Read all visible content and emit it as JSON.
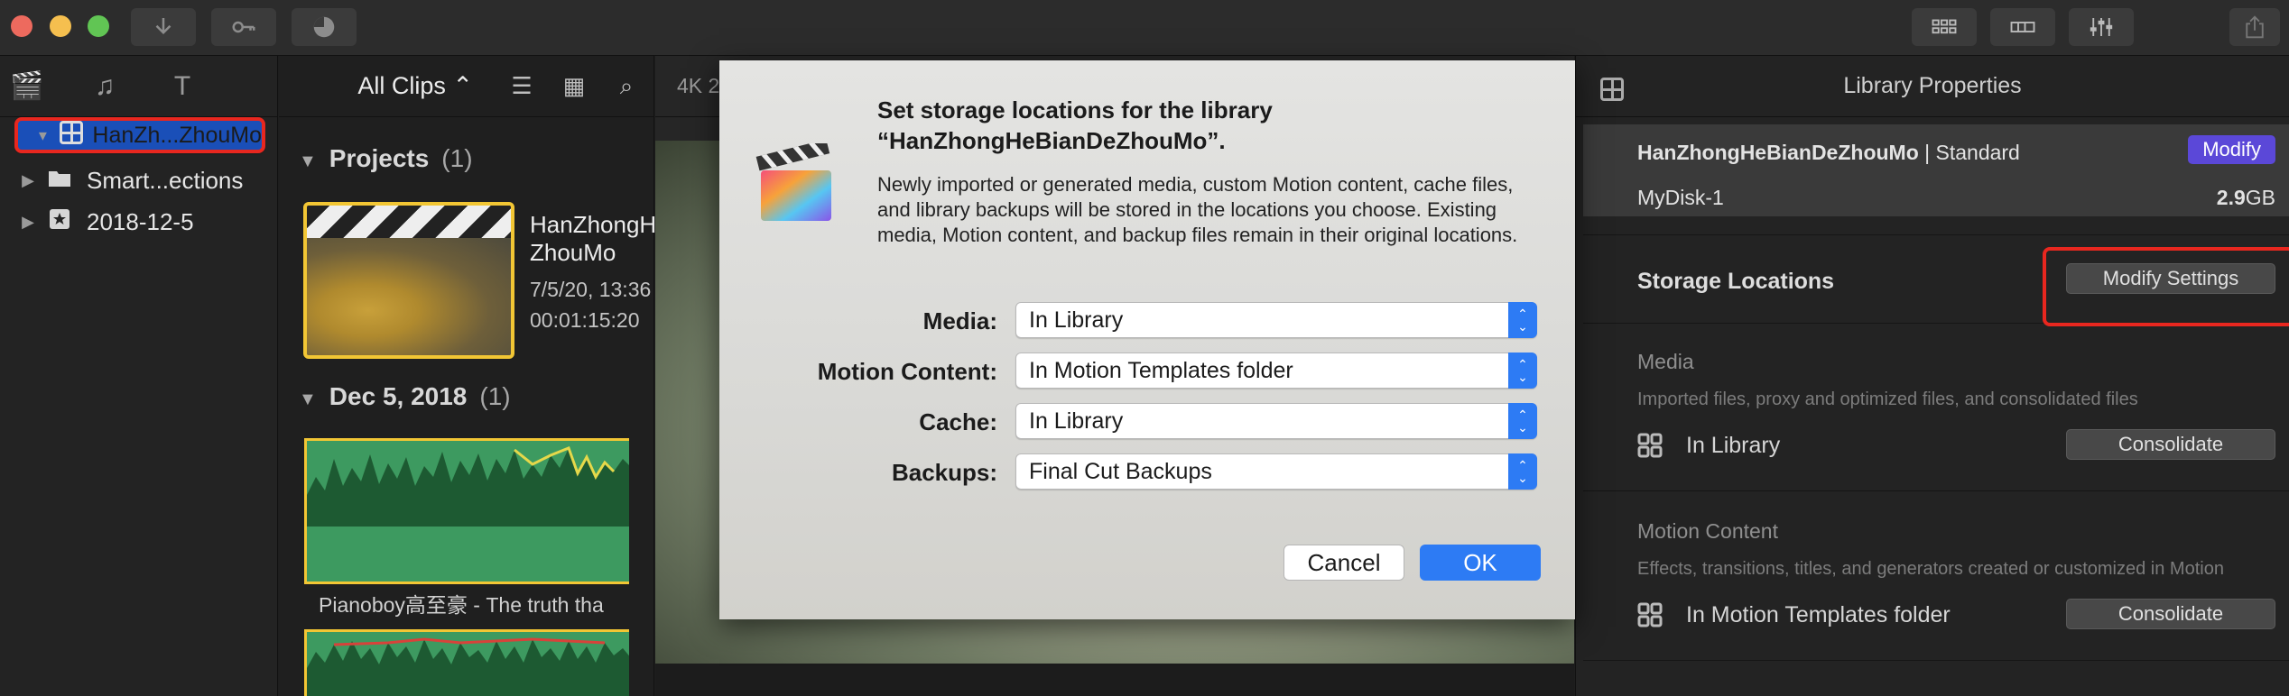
{
  "toolbar": {
    "import_icon": "download-arrow-icon",
    "keywords_icon": "key-icon",
    "background_tasks_icon": "progress-circle-icon",
    "right_buttons": [
      "grid-view-icon",
      "filmstrip-icon",
      "sliders-icon"
    ],
    "share_icon": "share-icon"
  },
  "sidebar": {
    "items": [
      {
        "label": "HanZh...ZhouMo",
        "icon": "library-icon"
      },
      {
        "label": "Smart...ections",
        "icon": "folder-icon"
      },
      {
        "label": "2018-12-5",
        "icon": "star-icon"
      }
    ]
  },
  "browser": {
    "filter": "All Clips ⌃",
    "projects": {
      "title": "Projects",
      "count": "(1)"
    },
    "project_clip": {
      "name_line1": "HanZhongH",
      "name_line2": "ZhouMo",
      "date": "7/5/20, 13:36",
      "duration": "00:01:15:20"
    },
    "event": {
      "title": "Dec 5, 2018",
      "count": "(1)"
    },
    "audio_caption": "Pianoboy高至豪 - The truth tha"
  },
  "viewer": {
    "format": "4K 2"
  },
  "inspector": {
    "title": "Library Properties",
    "library_name": "HanZhongHeBianDeZhouMo",
    "library_sep": " | Standard",
    "modify_label": "Modify",
    "disk_name": "MyDisk-1",
    "disk_size_num": "2.9",
    "disk_size_unit": "GB",
    "storage_title": "Storage Locations",
    "modify_settings_label": "Modify Settings",
    "media_label": "Media",
    "media_desc": "Imported files, proxy and optimized files, and consolidated files",
    "media_value": "In Library",
    "consolidate_label": "Consolidate",
    "motion_label": "Motion Content",
    "motion_desc": "Effects, transitions, titles, and generators created or customized in Motion",
    "motion_value": "In Motion Templates folder"
  },
  "dialog": {
    "title_line1": "Set storage locations for the library",
    "title_line2": "“HanZhongHeBianDeZhouMo”.",
    "body": "Newly imported or generated media, custom Motion content, cache files, and library backups will be stored in the locations you choose. Existing media, Motion content, and backup files remain in their original locations.",
    "fields": [
      {
        "label": "Media:",
        "value": "In Library"
      },
      {
        "label": "Motion Content:",
        "value": "In Motion Templates folder"
      },
      {
        "label": "Cache:",
        "value": "In Library"
      },
      {
        "label": "Backups:",
        "value": "Final Cut Backups"
      }
    ],
    "cancel_label": "Cancel",
    "ok_label": "OK"
  },
  "colors": {
    "accent_blue": "#2d7bf4",
    "selection_blue": "#1a4fb8",
    "highlight_red": "#e8271f",
    "modify_purple": "#5b48d8",
    "thumb_yellow": "#f2c634",
    "audio_green": "#3d9a60"
  }
}
